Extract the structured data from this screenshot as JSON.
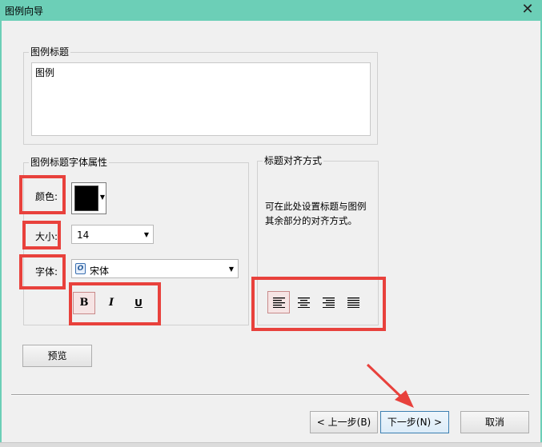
{
  "window": {
    "title": "图例向导",
    "close_glyph": "✕"
  },
  "legend_title": {
    "group_label": "图例标题",
    "value": "图例"
  },
  "font_props": {
    "group_label": "图例标题字体属性",
    "color_label": "颜色:",
    "color_value": "#000000",
    "size_label": "大小:",
    "size_value": "14",
    "font_label": "字体:",
    "font_value": "宋体",
    "bold_label": "B",
    "italic_label": "I",
    "underline_label": "U"
  },
  "alignment": {
    "group_label": "标题对齐方式",
    "hint": "可在此处设置标题与图例其余部分的对齐方式。",
    "options": [
      "align-left",
      "align-center",
      "align-right",
      "align-justify"
    ],
    "selected": "align-left"
  },
  "buttons": {
    "preview": "预览",
    "back": "< 上一步(B)",
    "next": "下一步(N) >",
    "cancel": "取消"
  },
  "annotation_color": "#e8413c"
}
